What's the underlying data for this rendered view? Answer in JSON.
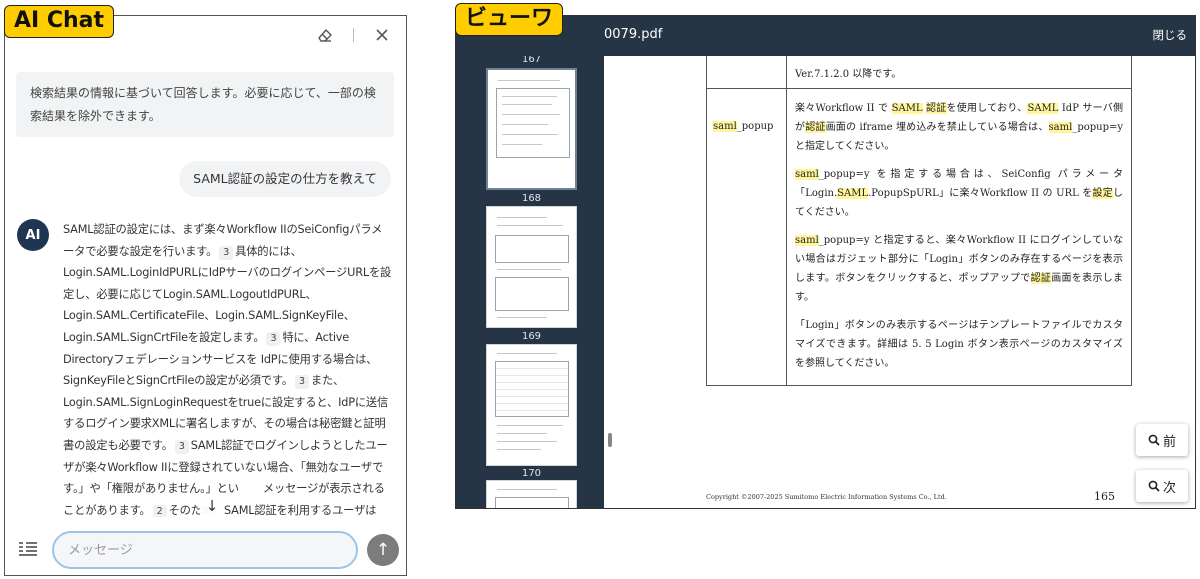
{
  "chat": {
    "label": "AI Chat",
    "system_message": "検索結果の情報に基づいて回答します。必要に応じて、一部の検索結果を除外できます。",
    "user_message": "SAML認証の設定の仕方を教えて",
    "avatar_text": "AI",
    "answer": {
      "t1": "SAML認証の設定には、まず楽々Workflow IIのSeiConfigパラメータで必要な設定を行います。",
      "c1": "3",
      "t2": "具体的には、Login.SAML.LoginIdPURLにIdPサーバのログインページURLを設定し、必要に応じてLogin.SAML.LogoutIdPURL、Login.SAML.CertificateFile、Login.SAML.SignKeyFile、Login.SAML.SignCrtFileを設定します。",
      "c2": "3",
      "t3": "特に、Active Directoryフェデレーションサービスを IdPに使用する場合は、SignKeyFileとSignCrtFileの設定が必須です。",
      "c3": "3",
      "t4": "また、Login.SAML.SignLoginRequestをtrueに設定すると、IdPに送信するログイン要求XMLに署名しますが、その場合は秘密鍵と証明書の設定も必要です。",
      "c4": "3",
      "t5": "SAML認証でログインしようとしたユーザが楽々Workflow IIに登録されていない場合、「無効なユーザです。」や「権限がありません。」とい",
      "t6": "メッセージが表示されることがあります。",
      "c5": "2",
      "t7": "そのため、SAML認証を利用するユーザは楽々Workflow"
    },
    "scroll_down_glyph": "↓",
    "input_placeholder": "メッセージ",
    "send_glyph": "↑"
  },
  "viewer": {
    "label": "ビューワ",
    "file_name": "0079.pdf",
    "close_label": "閉じる",
    "thumbnails": [
      {
        "page": "167"
      },
      {
        "page": "168"
      },
      {
        "page": "169"
      },
      {
        "page": "170"
      }
    ],
    "doc": {
      "row1_value": "Ver.7.1.2.0 以降です。",
      "row2_key_hl": "saml",
      "row2_key_rest": "_popup",
      "p1": {
        "a": "楽々Workflow II で ",
        "b": "SAML",
        "c": " ",
        "d": "認証",
        "e": "を使用しており、",
        "f": "SAML",
        "g": " IdP サーバ側が",
        "h": "認証",
        "i": "画面の iframe 埋め込みを禁止している場合は、",
        "j": "saml",
        "k": "_popup=y と指定してください。"
      },
      "p2": {
        "a": "saml",
        "b": "_popup=y を指定する場合は、SeiConfig パラメータ「Login.",
        "c": "SAML",
        "d": ".PopupSpURL」に楽々Workflow II の URL を",
        "e": "設定",
        "f": "してください。"
      },
      "p3": {
        "a": "saml",
        "b": "_popup=y と指定すると、楽々Workflow II にログインしていない場合はガジェット部分に「Login」ボタンのみ存在するページを表示します。ボタンをクリックすると、ポップアップで",
        "c": "認証",
        "d": "画面を表示します。"
      },
      "p4": "「Login」ボタンのみ表示するページはテンプレートファイルでカスタマイズできます。詳細は 5. 5 Login ボタン表示ページのカスタマイズ を参照してください。",
      "copyright": "Copyright ©2007-2025 Sumitomo Electric Information Systems Co., Ltd.",
      "page_number": "165"
    },
    "prev_label": "前",
    "next_label": "次"
  },
  "colors": {
    "label_yellow": "#ffcc00",
    "viewer_dark": "#253545",
    "highlight": "#fff59a",
    "avatar": "#1f3552"
  }
}
